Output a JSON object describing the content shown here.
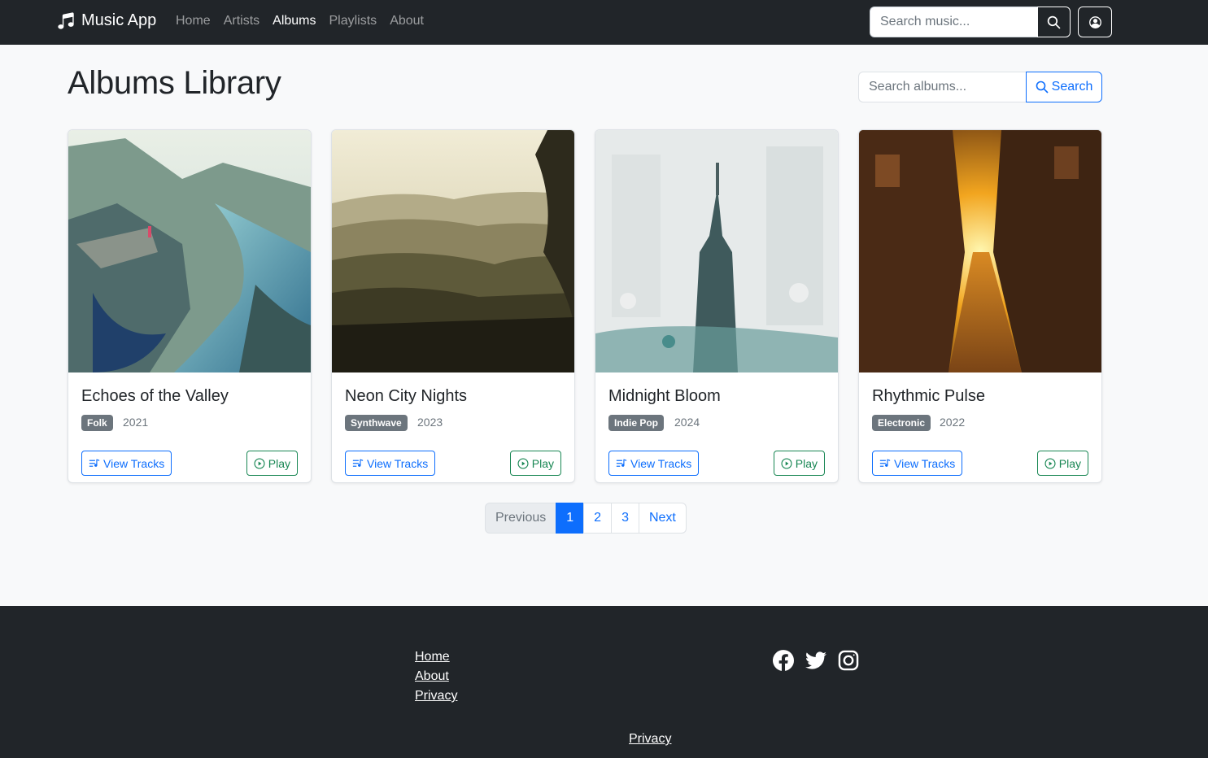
{
  "navbar": {
    "brand": "Music App",
    "links": [
      {
        "label": "Home",
        "active": false
      },
      {
        "label": "Artists",
        "active": false
      },
      {
        "label": "Albums",
        "active": true
      },
      {
        "label": "Playlists",
        "active": false
      },
      {
        "label": "About",
        "active": false
      }
    ],
    "search_placeholder": "Search music...",
    "icons": {
      "brand": "music-note-icon",
      "search": "search-icon",
      "user": "user-circle-icon"
    }
  },
  "header": {
    "title": "Albums Library",
    "search_placeholder": "Search albums...",
    "search_button": "Search"
  },
  "albums": [
    {
      "title": "Echoes of the Valley",
      "genre": "Folk",
      "year": "2021",
      "view_label": "View Tracks",
      "play_label": "Play",
      "image": "mountain-fjord-landscape"
    },
    {
      "title": "Neon City Nights",
      "genre": "Synthwave",
      "year": "2023",
      "view_label": "View Tracks",
      "play_label": "Play",
      "image": "misty-hills-sunrise"
    },
    {
      "title": "Midnight Bloom",
      "genre": "Indie Pop",
      "year": "2024",
      "view_label": "View Tracks",
      "play_label": "Play",
      "image": "skyscraper-double-exposure"
    },
    {
      "title": "Rhythmic Pulse",
      "genre": "Electronic",
      "year": "2022",
      "view_label": "View Tracks",
      "play_label": "Play",
      "image": "sunset-city-street"
    }
  ],
  "pagination": {
    "previous": "Previous",
    "pages": [
      "1",
      "2",
      "3"
    ],
    "active_page": "1",
    "next": "Next"
  },
  "footer": {
    "links": [
      "Home",
      "About",
      "Privacy"
    ],
    "social": [
      "facebook-icon",
      "twitter-icon",
      "instagram-icon"
    ],
    "bottom_link": "Privacy"
  },
  "colors": {
    "navbar_bg": "#212529",
    "primary": "#0d6efd",
    "success": "#198754",
    "badge": "#6c757d",
    "page_bg": "#f8f9fa"
  }
}
